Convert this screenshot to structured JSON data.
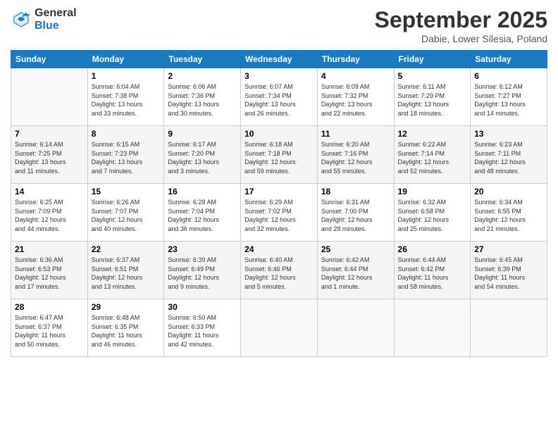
{
  "logo": {
    "general": "General",
    "blue": "Blue"
  },
  "title": "September 2025",
  "subtitle": "Dabie, Lower Silesia, Poland",
  "weekdays": [
    "Sunday",
    "Monday",
    "Tuesday",
    "Wednesday",
    "Thursday",
    "Friday",
    "Saturday"
  ],
  "weeks": [
    [
      {
        "day": "",
        "info": ""
      },
      {
        "day": "1",
        "info": "Sunrise: 6:04 AM\nSunset: 7:38 PM\nDaylight: 13 hours\nand 33 minutes."
      },
      {
        "day": "2",
        "info": "Sunrise: 6:06 AM\nSunset: 7:36 PM\nDaylight: 13 hours\nand 30 minutes."
      },
      {
        "day": "3",
        "info": "Sunrise: 6:07 AM\nSunset: 7:34 PM\nDaylight: 13 hours\nand 26 minutes."
      },
      {
        "day": "4",
        "info": "Sunrise: 6:09 AM\nSunset: 7:32 PM\nDaylight: 13 hours\nand 22 minutes."
      },
      {
        "day": "5",
        "info": "Sunrise: 6:11 AM\nSunset: 7:29 PM\nDaylight: 13 hours\nand 18 minutes."
      },
      {
        "day": "6",
        "info": "Sunrise: 6:12 AM\nSunset: 7:27 PM\nDaylight: 13 hours\nand 14 minutes."
      }
    ],
    [
      {
        "day": "7",
        "info": "Sunrise: 6:14 AM\nSunset: 7:25 PM\nDaylight: 13 hours\nand 11 minutes."
      },
      {
        "day": "8",
        "info": "Sunrise: 6:15 AM\nSunset: 7:23 PM\nDaylight: 13 hours\nand 7 minutes."
      },
      {
        "day": "9",
        "info": "Sunrise: 6:17 AM\nSunset: 7:20 PM\nDaylight: 13 hours\nand 3 minutes."
      },
      {
        "day": "10",
        "info": "Sunrise: 6:18 AM\nSunset: 7:18 PM\nDaylight: 12 hours\nand 59 minutes."
      },
      {
        "day": "11",
        "info": "Sunrise: 6:20 AM\nSunset: 7:16 PM\nDaylight: 12 hours\nand 55 minutes."
      },
      {
        "day": "12",
        "info": "Sunrise: 6:22 AM\nSunset: 7:14 PM\nDaylight: 12 hours\nand 52 minutes."
      },
      {
        "day": "13",
        "info": "Sunrise: 6:23 AM\nSunset: 7:11 PM\nDaylight: 12 hours\nand 48 minutes."
      }
    ],
    [
      {
        "day": "14",
        "info": "Sunrise: 6:25 AM\nSunset: 7:09 PM\nDaylight: 12 hours\nand 44 minutes."
      },
      {
        "day": "15",
        "info": "Sunrise: 6:26 AM\nSunset: 7:07 PM\nDaylight: 12 hours\nand 40 minutes."
      },
      {
        "day": "16",
        "info": "Sunrise: 6:28 AM\nSunset: 7:04 PM\nDaylight: 12 hours\nand 36 minutes."
      },
      {
        "day": "17",
        "info": "Sunrise: 6:29 AM\nSunset: 7:02 PM\nDaylight: 12 hours\nand 32 minutes."
      },
      {
        "day": "18",
        "info": "Sunrise: 6:31 AM\nSunset: 7:00 PM\nDaylight: 12 hours\nand 28 minutes."
      },
      {
        "day": "19",
        "info": "Sunrise: 6:32 AM\nSunset: 6:58 PM\nDaylight: 12 hours\nand 25 minutes."
      },
      {
        "day": "20",
        "info": "Sunrise: 6:34 AM\nSunset: 6:55 PM\nDaylight: 12 hours\nand 21 minutes."
      }
    ],
    [
      {
        "day": "21",
        "info": "Sunrise: 6:36 AM\nSunset: 6:53 PM\nDaylight: 12 hours\nand 17 minutes."
      },
      {
        "day": "22",
        "info": "Sunrise: 6:37 AM\nSunset: 6:51 PM\nDaylight: 12 hours\nand 13 minutes."
      },
      {
        "day": "23",
        "info": "Sunrise: 6:39 AM\nSunset: 6:49 PM\nDaylight: 12 hours\nand 9 minutes."
      },
      {
        "day": "24",
        "info": "Sunrise: 6:40 AM\nSunset: 6:46 PM\nDaylight: 12 hours\nand 5 minutes."
      },
      {
        "day": "25",
        "info": "Sunrise: 6:42 AM\nSunset: 6:44 PM\nDaylight: 12 hours\nand 1 minute."
      },
      {
        "day": "26",
        "info": "Sunrise: 6:44 AM\nSunset: 6:42 PM\nDaylight: 11 hours\nand 58 minutes."
      },
      {
        "day": "27",
        "info": "Sunrise: 6:45 AM\nSunset: 6:39 PM\nDaylight: 11 hours\nand 54 minutes."
      }
    ],
    [
      {
        "day": "28",
        "info": "Sunrise: 6:47 AM\nSunset: 6:37 PM\nDaylight: 11 hours\nand 50 minutes."
      },
      {
        "day": "29",
        "info": "Sunrise: 6:48 AM\nSunset: 6:35 PM\nDaylight: 11 hours\nand 46 minutes."
      },
      {
        "day": "30",
        "info": "Sunrise: 6:50 AM\nSunset: 6:33 PM\nDaylight: 11 hours\nand 42 minutes."
      },
      {
        "day": "",
        "info": ""
      },
      {
        "day": "",
        "info": ""
      },
      {
        "day": "",
        "info": ""
      },
      {
        "day": "",
        "info": ""
      }
    ]
  ]
}
